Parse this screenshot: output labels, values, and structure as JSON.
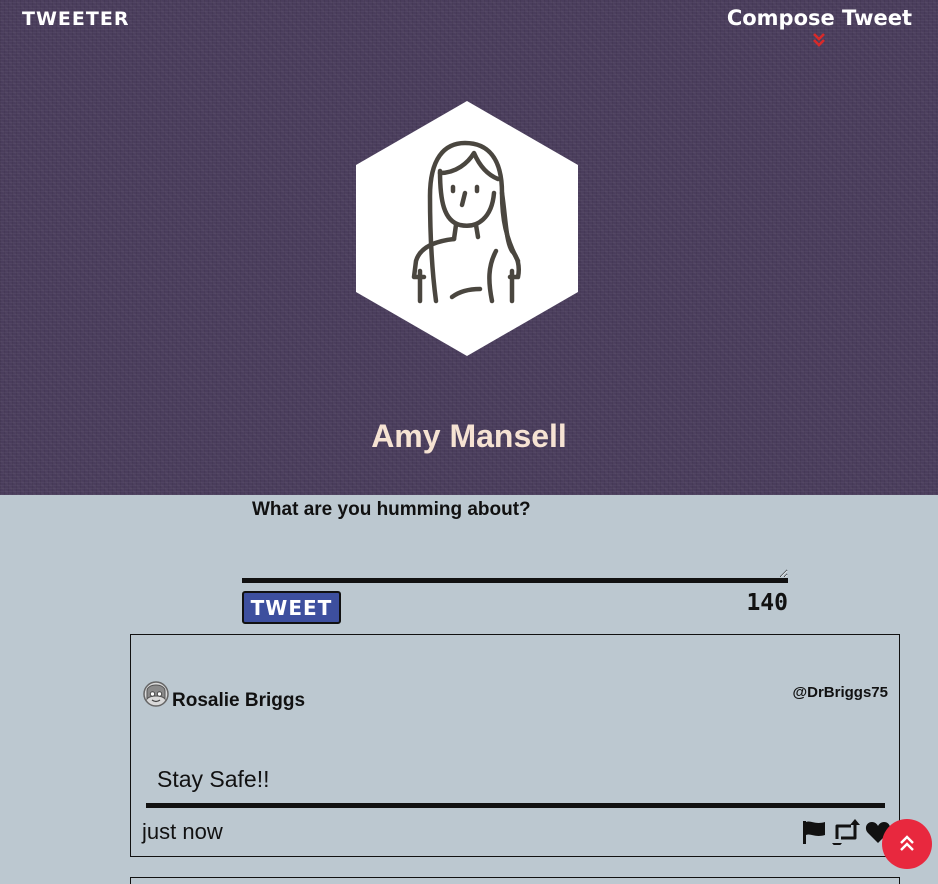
{
  "nav": {
    "brand": "TWEETER",
    "compose_label": "Compose Tweet",
    "compose_icon": "double-chevron-down-icon"
  },
  "profile": {
    "name": "Amy Mansell",
    "avatar_icon": "woman-avatar-icon"
  },
  "compose": {
    "prompt": "What are you humming about?",
    "input_value": "",
    "button_label": "TWEET",
    "counter": "140"
  },
  "tweets": [
    {
      "name": "Rosalie Briggs",
      "handle": "@DrBriggs75",
      "text": "Stay Safe!!",
      "time": "just now",
      "actions": [
        "flag-icon",
        "retweet-icon",
        "heart-icon"
      ]
    }
  ],
  "scroll_top_icon": "double-chevron-up-icon",
  "colors": {
    "header_bg": "#4a3d5c",
    "page_bg": "#bcc8d0",
    "name_color": "#f6e3d3",
    "tweet_button": "#3d4f9e",
    "chevron_red": "#d82a2a",
    "scroll_button": "#e8283e"
  }
}
